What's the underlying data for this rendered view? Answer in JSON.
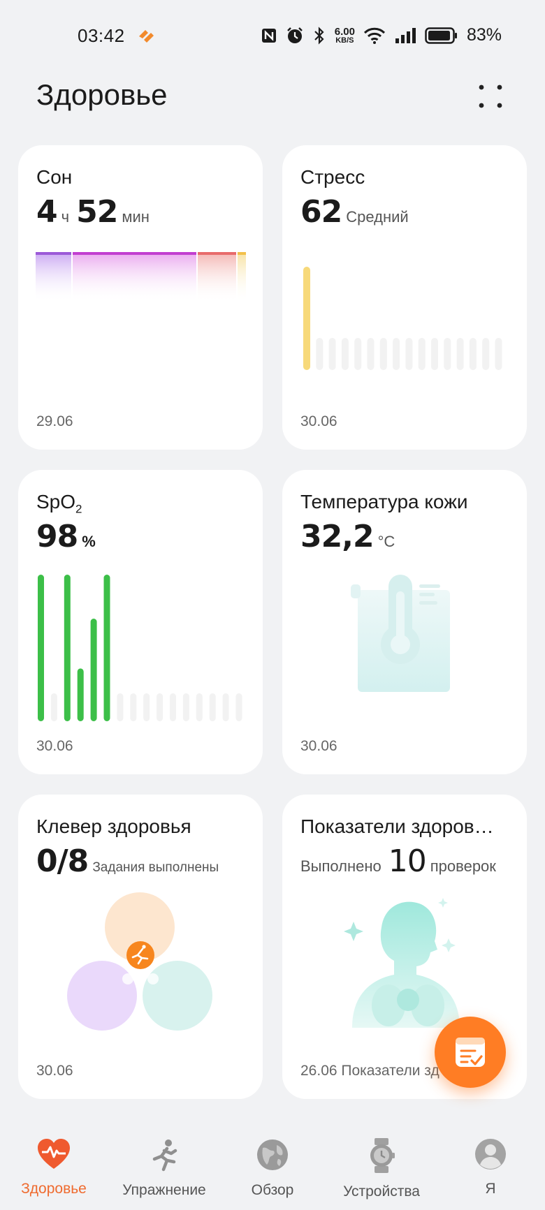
{
  "status_bar": {
    "time": "03:42",
    "net_speed_value": "6.00",
    "net_speed_unit": "KB/S",
    "battery": "83%"
  },
  "header": {
    "title": "Здоровье"
  },
  "cards": {
    "sleep": {
      "title": "Сон",
      "hours": "4",
      "hours_unit": "ч",
      "minutes": "52",
      "minutes_unit": "мин",
      "date": "29.06"
    },
    "stress": {
      "title": "Стресс",
      "value": "62",
      "level": "Средний",
      "date": "30.06"
    },
    "spo2": {
      "title": "SpO",
      "title_sub": "2",
      "value": "98",
      "unit": "%",
      "date": "30.06"
    },
    "skin_temp": {
      "title": "Температура кожи",
      "value": "32,2",
      "unit": "°C",
      "date": "30.06"
    },
    "clover": {
      "title": "Клевер здоровья",
      "value": "0/8",
      "caption": "Задания выполнены",
      "date": "30.06"
    },
    "indicators": {
      "title": "Показатели здоров…",
      "prefix": "Выполнено",
      "value": "10",
      "suffix": "проверок",
      "date": "26.06 Показатели зд"
    }
  },
  "bottom_nav": [
    {
      "label": "Здоровье",
      "icon": "heart-pulse-icon",
      "active": true
    },
    {
      "label": "Упражнение",
      "icon": "running-icon",
      "active": false
    },
    {
      "label": "Обзор",
      "icon": "globe-icon",
      "active": false
    },
    {
      "label": "Устройства",
      "icon": "watch-icon",
      "active": false
    },
    {
      "label": "Я",
      "icon": "profile-icon",
      "active": false
    }
  ],
  "colors": {
    "accent": "#ef6b2f",
    "spo2_bar": "#3cbf48",
    "stress_bar": "#f7d97a",
    "card_bg": "#ffffff",
    "page_bg": "#f1f2f4"
  }
}
